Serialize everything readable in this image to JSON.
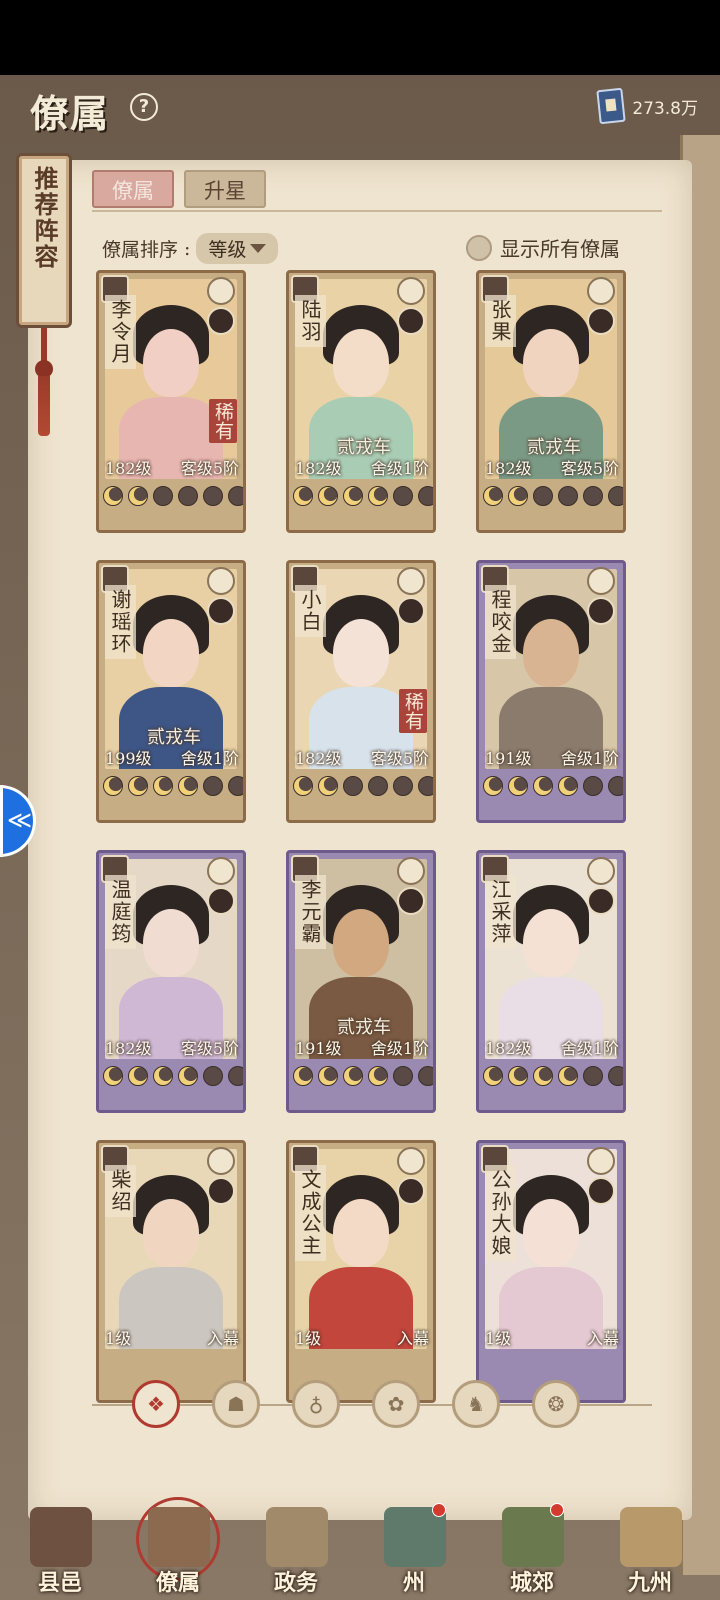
{
  "header": {
    "title": "僚属",
    "help": "?",
    "currency": "273.8万"
  },
  "side_banner": {
    "text": "推荐阵容"
  },
  "tabs": [
    {
      "label": "僚属",
      "active": true
    },
    {
      "label": "升星",
      "active": false
    }
  ],
  "sort": {
    "label": "僚属排序",
    "value": "等级"
  },
  "show_all": {
    "label": "显示所有僚属"
  },
  "cards": [
    {
      "name": "李令月",
      "frame": "gold",
      "rank": "",
      "level": "182级",
      "tier": "客级5阶",
      "rare": "稀有",
      "moons": 2,
      "skin": "#f2cfc4",
      "robe": "#e8b6b0",
      "bg": "#e7c99a"
    },
    {
      "name": "陆羽",
      "frame": "gold",
      "rank": "贰戎车",
      "level": "182级",
      "tier": "舍级1阶",
      "rare": "",
      "moons": 4,
      "skin": "#f3dcc8",
      "robe": "#a9ccb4",
      "bg": "#e9d3a6"
    },
    {
      "name": "张果",
      "frame": "gold",
      "rank": "贰戎车",
      "level": "182级",
      "tier": "客级5阶",
      "rare": "",
      "moons": 2,
      "skin": "#f0d4bf",
      "robe": "#7a9a86",
      "bg": "#e5c999"
    },
    {
      "name": "谢瑶环",
      "frame": "gold",
      "rank": "贰戎车",
      "level": "199级",
      "tier": "舍级1阶",
      "rare": "",
      "moons": 4,
      "skin": "#f2d6c3",
      "robe": "#3e5686",
      "bg": "#e8d0a4"
    },
    {
      "name": "小白",
      "frame": "gold",
      "rank": "",
      "level": "182级",
      "tier": "客级5阶",
      "rare": "稀有",
      "moons": 2,
      "skin": "#f5e2d6",
      "robe": "#d8e2ea",
      "bg": "#ead6b2"
    },
    {
      "name": "程咬金",
      "frame": "purple",
      "rank": "",
      "level": "191级",
      "tier": "舍级1阶",
      "rare": "",
      "moons": 4,
      "skin": "#d9b492",
      "robe": "#8a7b6c",
      "bg": "#d8c6a8"
    },
    {
      "name": "温庭筠",
      "frame": "purple",
      "rank": "",
      "level": "182级",
      "tier": "客级5阶",
      "rare": "",
      "moons": 4,
      "skin": "#f0dcd0",
      "robe": "#cfb8d4",
      "bg": "#e6d8c6"
    },
    {
      "name": "李元霸",
      "frame": "purple",
      "rank": "贰戎车",
      "level": "191级",
      "tier": "舍级1阶",
      "rare": "",
      "moons": 4,
      "skin": "#d1a880",
      "robe": "#7a5a42",
      "bg": "#cfbfa2"
    },
    {
      "name": "江采萍",
      "frame": "purple",
      "rank": "",
      "level": "182级",
      "tier": "舍级1阶",
      "rare": "",
      "moons": 4,
      "skin": "#f5e0d4",
      "robe": "#e9dde6",
      "bg": "#ece2d4"
    },
    {
      "name": "柴绍",
      "frame": "gold",
      "rank": "",
      "level": "1级",
      "tier": "入幕",
      "rare": "",
      "moons": 0,
      "skin": "#f0d6c0",
      "robe": "#cbc7c0",
      "bg": "#e9d8b8"
    },
    {
      "name": "文成公主",
      "frame": "gold",
      "rank": "",
      "level": "1级",
      "tier": "入幕",
      "rare": "",
      "moons": 0,
      "skin": "#f3dac6",
      "robe": "#c2463c",
      "bg": "#e8d3a8"
    },
    {
      "name": "公孙大娘",
      "frame": "purple",
      "rank": "",
      "level": "1级",
      "tier": "入幕",
      "rare": "",
      "moons": 0,
      "skin": "#f5e0d6",
      "robe": "#e4c8d2",
      "bg": "#ece0d8"
    }
  ],
  "filters": [
    {
      "icon": "all-icon",
      "glyph": "❖",
      "active": true
    },
    {
      "icon": "helmet-icon",
      "glyph": "☗",
      "active": false
    },
    {
      "icon": "gourd-icon",
      "glyph": "♁",
      "active": false
    },
    {
      "icon": "fan-icon",
      "glyph": "✿",
      "active": false
    },
    {
      "icon": "lion-icon",
      "glyph": "♞",
      "active": false
    },
    {
      "icon": "scroll-icon",
      "glyph": "❂",
      "active": false
    }
  ],
  "nav": [
    {
      "label": "县邑",
      "color": "#6e5140",
      "dot": false,
      "selected": false
    },
    {
      "label": "僚属",
      "color": "#8c6a50",
      "dot": false,
      "selected": true
    },
    {
      "label": "政务",
      "color": "#a08a6a",
      "dot": false,
      "selected": false
    },
    {
      "label": "州",
      "color": "#5f7a6a",
      "dot": true,
      "selected": false
    },
    {
      "label": "城郊",
      "color": "#6a7a4e",
      "dot": true,
      "selected": false
    },
    {
      "label": "九州",
      "color": "#b89a6a",
      "dot": false,
      "selected": false
    }
  ]
}
